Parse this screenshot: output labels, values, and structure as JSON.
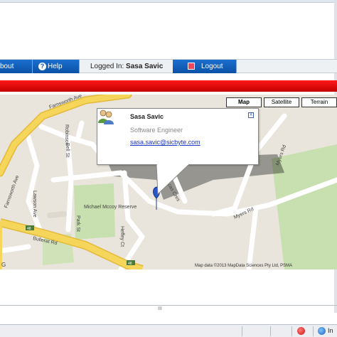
{
  "nav": {
    "about_label": "bout",
    "help_label": "Help",
    "logged_in_prefix": "Logged In:",
    "logged_in_user": "Sasa Savic",
    "logout_label": "Logout"
  },
  "map": {
    "types": [
      "Map",
      "Satellite",
      "Terrain"
    ],
    "active_type": "Map",
    "streets": [
      "Farnsworth Ave",
      "Robinson",
      "Bell St",
      "Farnsworth Ave",
      "Lawson Ave",
      "Michael Mccoy Reserve",
      "Bullerat Rd",
      "Park St",
      "Heffey Ct",
      "Myers Rd",
      "Myers Rd",
      "Lucas Cres"
    ],
    "road_markers": [
      "48",
      "48"
    ],
    "attribution": "Map data ©2013 MapData Sciences Pty Ltd, PSMA",
    "google_logo": "G",
    "info": {
      "name": "Sasa Savic",
      "title": "Software Engineer",
      "email": "sasa.savic@sicbyte.com",
      "close": "x"
    }
  },
  "status": {
    "zone_text": "In",
    "bottom_mark": "III"
  },
  "colors": {
    "nav_blue": "#0b52a6",
    "banner_red": "#e00000",
    "map_bg": "#e9e5dc",
    "road_yellow": "#f5d55a",
    "park_green": "#c8dfb0"
  }
}
